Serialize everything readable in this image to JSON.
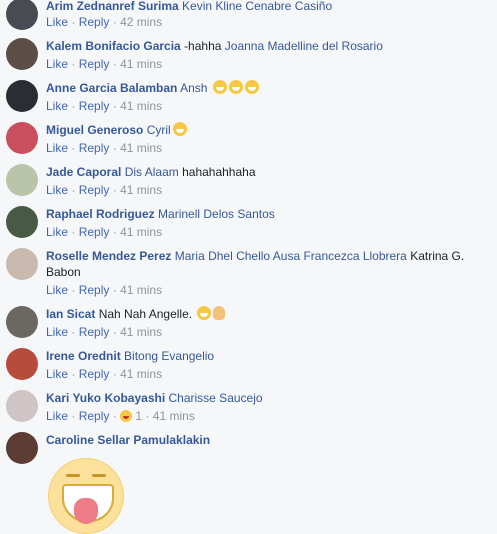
{
  "actions": {
    "like": "Like",
    "reply": "Reply",
    "dot": "·"
  },
  "comments": [
    {
      "name": "Arim Zednanref Surima",
      "parts": [
        "Kevin Kline Cenabre Casiño"
      ],
      "time": "42 mins",
      "avatar": "#4a4a52"
    },
    {
      "name": "Kalem Bonifacio Garcia",
      "parts": [
        "-hahha",
        "Joanna Madelline del Rosario"
      ],
      "time": "41 mins",
      "avatar": "#5a4e46"
    },
    {
      "name": "Anne Garcia Balamban",
      "parts": [
        "Ansh"
      ],
      "time": "41 mins",
      "avatar": "#2c2c34"
    },
    {
      "name": "Miguel Generoso",
      "parts": [
        "Cyril"
      ],
      "time": "41 mins",
      "avatar": "#c94f5e"
    },
    {
      "name": "Jade Caporal",
      "parts": [
        "Dis Alaam",
        "hahahahhaha"
      ],
      "time": "41 mins",
      "avatar": "#b9c4a8"
    },
    {
      "name": "Raphael Rodriguez",
      "parts": [
        "Marinell Delos Santos"
      ],
      "time": "41 mins",
      "avatar": "#485a44"
    },
    {
      "name": "Roselle Mendez Perez",
      "parts": [
        "Maria Dhel Chello Ausa Francezca Llobrera",
        "Katrina G.",
        "Babon"
      ],
      "time": "41 mins",
      "avatar": "#c9b9ae"
    },
    {
      "name": "Ian Sicat",
      "parts": [
        "Nah Nah Angelle."
      ],
      "time": "41 mins",
      "avatar": "#6a6860"
    },
    {
      "name": "Irene Orednit",
      "parts": [
        "Bitong Evangelio"
      ],
      "time": "41 mins",
      "avatar": "#b84c3a"
    },
    {
      "name": "Kari Yuko Kobayashi",
      "parts": [
        "Charisse Saucejo"
      ],
      "time": "41 mins",
      "reactions": "1",
      "avatar": "#cfc4c6"
    },
    {
      "name": "Caroline Sellar Pamulaklakin",
      "parts": [],
      "time": "",
      "avatar": "#5b3d33"
    }
  ]
}
